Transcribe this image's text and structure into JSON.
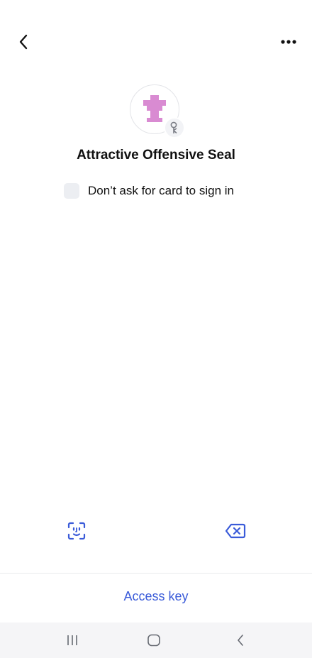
{
  "header": {
    "back_icon": "chevron-left-icon",
    "more_icon": "more-horizontal-icon"
  },
  "profile": {
    "name": "Attractive Offensive Seal",
    "avatar_icon": "identicon-avatar",
    "avatar_color": "#d98bd2",
    "badge_icon": "key-icon"
  },
  "options": {
    "dont_ask_card_label": "Don’t ask for card to sign in",
    "dont_ask_card_checked": false
  },
  "actions": {
    "face_id_icon": "face-id-icon",
    "backspace_icon": "backspace-icon",
    "access_key_label": "Access key"
  },
  "system_nav": {
    "recents_icon": "recents-icon",
    "home_icon": "home-icon",
    "back_icon": "back-icon"
  },
  "colors": {
    "accent": "#3a5bd9",
    "text": "#111111",
    "nav_bg": "#f5f5f7"
  }
}
